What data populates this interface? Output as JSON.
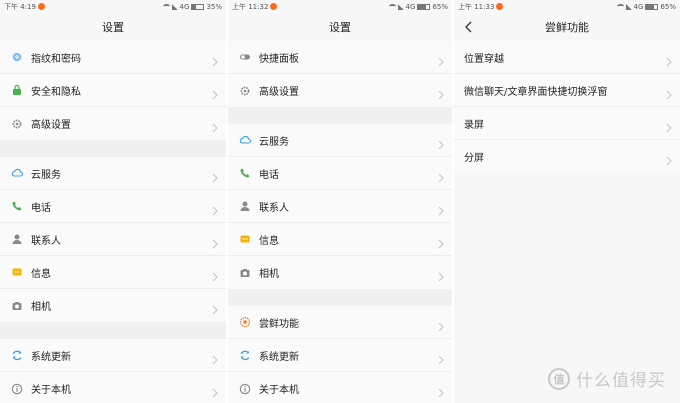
{
  "colors": {
    "green": "#4caf50",
    "blue": "#3aa0e8",
    "gray": "#8a8a8a",
    "yellow": "#f5b400",
    "orange": "#f07a2c",
    "accent_orange": "#ff6a1a"
  },
  "screen1": {
    "status": {
      "time": "下午 4:19",
      "net": "4G",
      "battery": "35%",
      "battery_level": 0.35
    },
    "title": "设置",
    "groups": [
      {
        "items": [
          {
            "name": "fingerprint",
            "label": "指纹和密码",
            "icon": "fingerprint-icon"
          },
          {
            "name": "security",
            "label": "安全和隐私",
            "icon": "lock-icon"
          },
          {
            "name": "advanced",
            "label": "高级设置",
            "icon": "gear-icon"
          }
        ]
      },
      {
        "items": [
          {
            "name": "cloud",
            "label": "云服务",
            "icon": "cloud-icon"
          },
          {
            "name": "phone",
            "label": "电话",
            "icon": "phone-icon"
          },
          {
            "name": "contacts",
            "label": "联系人",
            "icon": "person-icon"
          },
          {
            "name": "messages",
            "label": "信息",
            "icon": "message-icon"
          },
          {
            "name": "camera",
            "label": "相机",
            "icon": "camera-icon"
          }
        ]
      },
      {
        "items": [
          {
            "name": "update",
            "label": "系统更新",
            "icon": "refresh-icon"
          },
          {
            "name": "about",
            "label": "关于本机",
            "icon": "info-icon"
          }
        ]
      }
    ]
  },
  "screen2": {
    "status": {
      "time": "上午 11:32",
      "net": "4G",
      "battery": "65%",
      "battery_level": 0.65
    },
    "title": "设置",
    "groups": [
      {
        "items": [
          {
            "name": "quick-panel",
            "label": "快捷面板",
            "icon": "toggle-icon"
          },
          {
            "name": "advanced",
            "label": "高级设置",
            "icon": "gear-icon"
          }
        ]
      },
      {
        "items": [
          {
            "name": "cloud",
            "label": "云服务",
            "icon": "cloud-icon"
          },
          {
            "name": "phone",
            "label": "电话",
            "icon": "phone-icon"
          },
          {
            "name": "contacts",
            "label": "联系人",
            "icon": "person-icon"
          },
          {
            "name": "messages",
            "label": "信息",
            "icon": "message-icon"
          },
          {
            "name": "camera",
            "label": "相机",
            "icon": "camera-icon"
          }
        ]
      },
      {
        "items": [
          {
            "name": "early-features",
            "label": "尝鲜功能",
            "icon": "flower-icon"
          },
          {
            "name": "update",
            "label": "系统更新",
            "icon": "refresh-icon"
          },
          {
            "name": "about",
            "label": "关于本机",
            "icon": "info-icon"
          }
        ]
      }
    ]
  },
  "screen3": {
    "status": {
      "time": "上午 11:33",
      "net": "4G",
      "battery": "65%",
      "battery_level": 0.65
    },
    "title": "尝鲜功能",
    "items": [
      {
        "name": "position-wear",
        "label": "位置穿越"
      },
      {
        "name": "wechat-float",
        "label": "微信聊天/文章界面快捷切换浮窗"
      },
      {
        "name": "screen-record",
        "label": "录屏"
      },
      {
        "name": "split-screen",
        "label": "分屏"
      }
    ]
  },
  "watermark": {
    "logo": "值",
    "text": "什么值得买"
  }
}
